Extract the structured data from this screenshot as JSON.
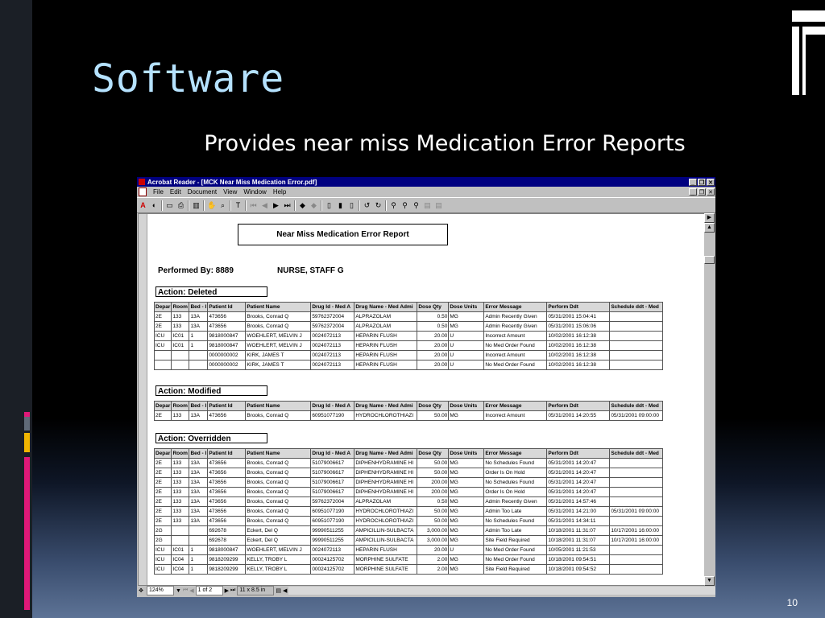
{
  "slide": {
    "title": "Software",
    "subtitle": "Provides near miss Medication Error Reports",
    "page_number": "10"
  },
  "window": {
    "title": "Acrobat Reader - [MCK Near Miss Medication Error.pdf]",
    "menu": [
      "File",
      "Edit",
      "Document",
      "View",
      "Window",
      "Help"
    ]
  },
  "report": {
    "title": "Near Miss Medication Error Report",
    "performed_by": "Performed By: 8889",
    "performer_name": "NURSE, STAFF G",
    "headers": [
      "Depar",
      "Room",
      "Bed - I",
      "Patient Id",
      "Patient Name",
      "Drug Id - Med A",
      "Drug Name - Med Admi",
      "Dose Qty",
      "Dose Units",
      "Error Message",
      "Perform Ddt",
      "Schedule ddt - Med"
    ],
    "sections": [
      {
        "action": "Action:   Deleted",
        "rows": [
          [
            "2E",
            "133",
            "13A",
            "473656",
            "Brooks, Conrad Q",
            "59762372004",
            "ALPRAZOLAM",
            "0.50",
            "MG",
            "Admin Recently Given",
            "05/31/2001 15:04:41",
            ""
          ],
          [
            "2E",
            "133",
            "13A",
            "473656",
            "Brooks, Conrad Q",
            "59762372004",
            "ALPRAZOLAM",
            "0.50",
            "MG",
            "Admin Recently Given",
            "05/31/2001 15:06:06",
            ""
          ],
          [
            "ICU",
            "IC01",
            "1",
            "9818000847",
            "WOEHLERT, MELVIN J",
            "0024072113",
            "HEPARIN FLUSH",
            "20.00",
            "U",
            "Incorrect Amount",
            "10/02/2001 16:12:38",
            ""
          ],
          [
            "ICU",
            "IC01",
            "1",
            "9818000847",
            "WOEHLERT, MELVIN J",
            "0024072113",
            "HEPARIN FLUSH",
            "20.00",
            "U",
            "No Med Order Found",
            "10/02/2001 16:12:38",
            ""
          ],
          [
            "",
            "",
            "",
            "0000000002",
            "KIRK, JAMES T",
            "0024072113",
            "HEPARIN FLUSH",
            "20.00",
            "U",
            "Incorrect Amount",
            "10/02/2001 16:12:38",
            ""
          ],
          [
            "",
            "",
            "",
            "0000000002",
            "KIRK, JAMES T",
            "0024072113",
            "HEPARIN FLUSH",
            "20.00",
            "U",
            "No Med Order Found",
            "10/02/2001 16:12:38",
            ""
          ]
        ]
      },
      {
        "action": "Action:   Modified",
        "rows": [
          [
            "2E",
            "133",
            "13A",
            "473656",
            "Brooks, Conrad Q",
            "60951077190",
            "HYDROCHLOROTHIAZI",
            "50.00",
            "MG",
            "Incorrect Amount",
            "05/31/2001 14:20:55",
            "05/31/2001 09:00:00"
          ]
        ]
      },
      {
        "action": "Action:   Overridden",
        "rows": [
          [
            "2E",
            "133",
            "13A",
            "473656",
            "Brooks, Conrad Q",
            "51079006617",
            "DIPHENHYDRAMINE HI",
            "50.00",
            "MG",
            "No Schedules Found",
            "05/31/2001 14:20:47",
            ""
          ],
          [
            "2E",
            "133",
            "13A",
            "473656",
            "Brooks, Conrad Q",
            "51079006617",
            "DIPHENHYDRAMINE HI",
            "50.00",
            "MG",
            "Order Is On Hold",
            "05/31/2001 14:20:47",
            ""
          ],
          [
            "2E",
            "133",
            "13A",
            "473656",
            "Brooks, Conrad Q",
            "51079006617",
            "DIPHENHYDRAMINE HI",
            "200.00",
            "MG",
            "No Schedules Found",
            "05/31/2001 14:20:47",
            ""
          ],
          [
            "2E",
            "133",
            "13A",
            "473656",
            "Brooks, Conrad Q",
            "51079006617",
            "DIPHENHYDRAMINE HI",
            "200.00",
            "MG",
            "Order Is On Hold",
            "05/31/2001 14:20:47",
            ""
          ],
          [
            "2E",
            "133",
            "13A",
            "473656",
            "Brooks, Conrad Q",
            "59762372004",
            "ALPRAZOLAM",
            "0.50",
            "MG",
            "Admin Recently Given",
            "05/31/2001 14:57:46",
            ""
          ],
          [
            "2E",
            "133",
            "13A",
            "473656",
            "Brooks, Conrad Q",
            "60951077190",
            "HYDROCHLOROTHIAZI",
            "50.00",
            "MG",
            "Admin Too Late",
            "05/31/2001 14:21:00",
            "05/31/2001 09:00:00"
          ],
          [
            "2E",
            "133",
            "13A",
            "473656",
            "Brooks, Conrad Q",
            "60951077190",
            "HYDROCHLOROTHIAZI",
            "50.00",
            "MG",
            "No Schedules Found",
            "05/31/2001 14:34:11",
            ""
          ],
          [
            "2G",
            "",
            "",
            "692678",
            "Eckert, Del Q",
            "99990511255",
            "AMPICILLIN-SULBACTA",
            "3,000.00",
            "MG",
            "Admin Too Late",
            "10/18/2001 11:31:07",
            "10/17/2001 16:00:00"
          ],
          [
            "2G",
            "",
            "",
            "692678",
            "Eckert, Del Q",
            "99990511255",
            "AMPICILLIN-SULBACTA",
            "3,000.00",
            "MG",
            "Site Field Required",
            "10/18/2001 11:31:07",
            "10/17/2001 16:00:00"
          ],
          [
            "ICU",
            "IC01",
            "1",
            "9818000847",
            "WOEHLERT, MELVIN J",
            "0024072113",
            "HEPARIN FLUSH",
            "20.00",
            "U",
            "No Med Order Found",
            "10/05/2001 11:21:53",
            ""
          ],
          [
            "ICU",
            "IC04",
            "1",
            "9818209299",
            "KELLY, TROBY L",
            "00024125702",
            "MORPHINE SULFATE",
            "2.00",
            "MG",
            "No Med Order Found",
            "10/18/2001 09:54:51",
            ""
          ],
          [
            "ICU",
            "IC04",
            "1",
            "9818209299",
            "KELLY, TROBY L",
            "00024125702",
            "MORPHINE SULFATE",
            "2.00",
            "MG",
            "Site Field Required",
            "10/18/2001 09:54:52",
            ""
          ]
        ]
      }
    ]
  },
  "status": {
    "zoom": "124%",
    "page": "1 of 2",
    "size": "11 x 8.5 in"
  },
  "colors": {
    "accent_pink": "#e01878",
    "accent_yellow": "#f0b400",
    "accent_gray": "#606a78"
  }
}
